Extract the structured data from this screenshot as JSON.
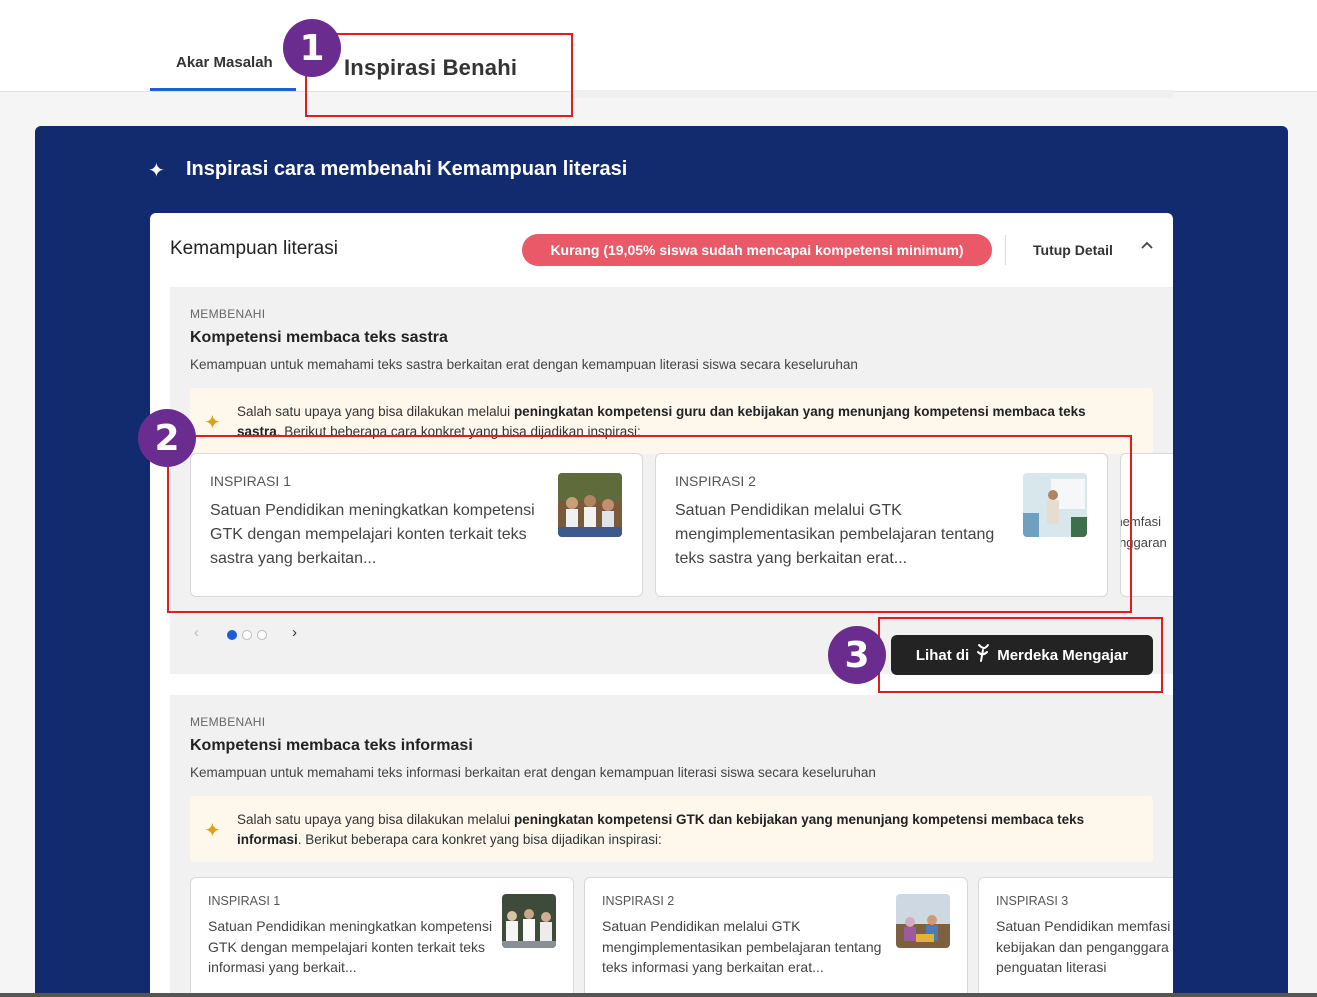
{
  "tabs": {
    "akar_masalah": "Akar Masalah",
    "inspirasi_benahi": "Inspirasi Benahi"
  },
  "markers": [
    "1",
    "2",
    "3"
  ],
  "panel": {
    "title": "Inspirasi cara membenahi Kemampuan literasi",
    "card_title": "Kemampuan literasi",
    "status_badge": "Kurang (19,05% siswa sudah mencapai kompetensi minimum)",
    "status_color": "#ea5968",
    "toggle_label": "Tutup Detail"
  },
  "section1": {
    "kicker": "MEMBENAHI",
    "heading": "Kompetensi membaca teks sastra",
    "description": "Kemampuan untuk memahami teks sastra berkaitan erat dengan kemampuan literasi siswa secara keseluruhan",
    "info_pre": "Salah satu upaya yang bisa dilakukan melalui ",
    "info_bold": "peningkatan kompetensi guru dan kebijakan yang menunjang kompetensi membaca teks sastra",
    "info_post": ". Berikut beberapa cara konkret yang bisa dijadikan inspirasi:",
    "cards": [
      {
        "label": "INSPIRASI 1",
        "text": "Satuan Pendidikan meningkatkan kompetensi GTK dengan mempelajari konten terkait teks sastra yang berkaitan..."
      },
      {
        "label": "INSPIRASI 2",
        "text": "Satuan Pendidikan melalui GTK mengimplementasikan pembelajaran tentang teks sastra yang berkaitan erat..."
      },
      {
        "label": "",
        "text": "...memfasi ...anggaran"
      }
    ],
    "button_prefix": "Lihat di",
    "button_brand": "Merdeka Mengajar"
  },
  "section2": {
    "kicker": "MEMBENAHI",
    "heading": "Kompetensi membaca teks informasi",
    "description": "Kemampuan untuk memahami teks informasi berkaitan erat dengan kemampuan literasi siswa secara keseluruhan",
    "info_pre": "Salah satu upaya yang bisa dilakukan melalui ",
    "info_bold": "peningkatan kompetensi GTK dan kebijakan yang menunjang kompetensi membaca teks informasi",
    "info_post": ". Berikut beberapa cara konkret yang bisa dijadikan inspirasi:",
    "cards": [
      {
        "label": "INSPIRASI 1",
        "text": "Satuan Pendidikan meningkatkan kompetensi GTK dengan mempelajari konten terkait teks informasi yang berkait..."
      },
      {
        "label": "INSPIRASI 2",
        "text": "Satuan Pendidikan melalui GTK mengimplementasikan pembelajaran tentang teks informasi yang berkaitan erat..."
      },
      {
        "label": "INSPIRASI 3",
        "text": "Satuan Pendidikan memfasi kebijakan dan penganggara penguatan literasi"
      }
    ]
  },
  "colors": {
    "navy": "#112b6e",
    "accent_blue": "#1a5fd6",
    "highlight_red": "#e01e1e",
    "marker_purple": "#6a2d8f"
  }
}
